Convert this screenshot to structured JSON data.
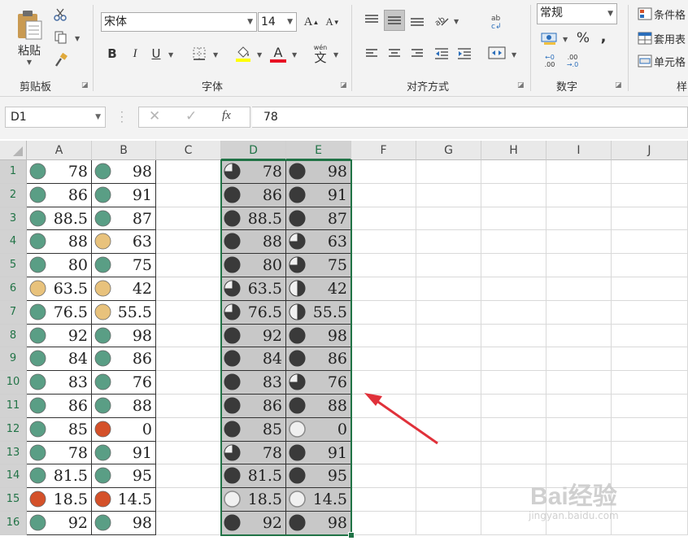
{
  "ribbon": {
    "clipboard": {
      "label": "剪贴板",
      "paste_label": "粘贴"
    },
    "font": {
      "label": "字体",
      "font_name": "宋体",
      "font_size": "14",
      "increase_symbol": "A",
      "decrease_symbol": "A",
      "bold": "B",
      "italic": "I",
      "underline": "U",
      "font_color_symbol": "A",
      "phonetic_top": "wén",
      "phonetic_char": "文"
    },
    "alignment": {
      "label": "对齐方式"
    },
    "number": {
      "label": "数字",
      "format": "常规",
      "percent": "%",
      "comma": ",",
      "inc_decimal_top": "←0",
      "inc_decimal_bottom": ".00",
      "dec_decimal_top": ".00",
      "dec_decimal_bottom": "→.0"
    },
    "styles": {
      "label": "样",
      "conditional": "条件格",
      "table": "套用表",
      "cell": "单元格"
    }
  },
  "formula_bar": {
    "name_box": "D1",
    "fx": "fx",
    "value": "78"
  },
  "columns": [
    "A",
    "B",
    "C",
    "D",
    "E",
    "F",
    "G",
    "H",
    "I",
    "J"
  ],
  "rows": [
    "1",
    "2",
    "3",
    "4",
    "5",
    "6",
    "7",
    "8",
    "9",
    "10",
    "11",
    "12",
    "13",
    "14",
    "15",
    "16"
  ],
  "colors": {
    "green": "#5a9e85",
    "yellow": "#e8c27c",
    "red": "#d4512a",
    "quarter_dark": "#3a3a3a",
    "accent": "#217346",
    "arrow": "#e0313a"
  },
  "sheet": {
    "A": [
      {
        "v": "78",
        "icon": "green"
      },
      {
        "v": "86",
        "icon": "green"
      },
      {
        "v": "88.5",
        "icon": "green"
      },
      {
        "v": "88",
        "icon": "green"
      },
      {
        "v": "80",
        "icon": "green"
      },
      {
        "v": "63.5",
        "icon": "yellow"
      },
      {
        "v": "76.5",
        "icon": "green"
      },
      {
        "v": "92",
        "icon": "green"
      },
      {
        "v": "84",
        "icon": "green"
      },
      {
        "v": "83",
        "icon": "green"
      },
      {
        "v": "86",
        "icon": "green"
      },
      {
        "v": "85",
        "icon": "green"
      },
      {
        "v": "78",
        "icon": "green"
      },
      {
        "v": "81.5",
        "icon": "green"
      },
      {
        "v": "18.5",
        "icon": "red"
      },
      {
        "v": "92",
        "icon": "green"
      }
    ],
    "B": [
      {
        "v": "98",
        "icon": "green"
      },
      {
        "v": "91",
        "icon": "green"
      },
      {
        "v": "87",
        "icon": "green"
      },
      {
        "v": "63",
        "icon": "yellow"
      },
      {
        "v": "75",
        "icon": "green"
      },
      {
        "v": "42",
        "icon": "yellow"
      },
      {
        "v": "55.5",
        "icon": "yellow"
      },
      {
        "v": "98",
        "icon": "green"
      },
      {
        "v": "86",
        "icon": "green"
      },
      {
        "v": "76",
        "icon": "green"
      },
      {
        "v": "88",
        "icon": "green"
      },
      {
        "v": "0",
        "icon": "red"
      },
      {
        "v": "91",
        "icon": "green"
      },
      {
        "v": "95",
        "icon": "green"
      },
      {
        "v": "14.5",
        "icon": "red"
      },
      {
        "v": "98",
        "icon": "green"
      }
    ],
    "D": [
      {
        "v": "78",
        "q": 3
      },
      {
        "v": "86",
        "q": 4
      },
      {
        "v": "88.5",
        "q": 4
      },
      {
        "v": "88",
        "q": 4
      },
      {
        "v": "80",
        "q": 4
      },
      {
        "v": "63.5",
        "q": 3
      },
      {
        "v": "76.5",
        "q": 3
      },
      {
        "v": "92",
        "q": 4
      },
      {
        "v": "84",
        "q": 4
      },
      {
        "v": "83",
        "q": 4
      },
      {
        "v": "86",
        "q": 4
      },
      {
        "v": "85",
        "q": 4
      },
      {
        "v": "78",
        "q": 3
      },
      {
        "v": "81.5",
        "q": 4
      },
      {
        "v": "18.5",
        "q": 0
      },
      {
        "v": "92",
        "q": 4
      }
    ],
    "E": [
      {
        "v": "98",
        "q": 4
      },
      {
        "v": "91",
        "q": 4
      },
      {
        "v": "87",
        "q": 4
      },
      {
        "v": "63",
        "q": 3
      },
      {
        "v": "75",
        "q": 3
      },
      {
        "v": "42",
        "q": 2
      },
      {
        "v": "55.5",
        "q": 2
      },
      {
        "v": "98",
        "q": 4
      },
      {
        "v": "86",
        "q": 4
      },
      {
        "v": "76",
        "q": 3
      },
      {
        "v": "88",
        "q": 4
      },
      {
        "v": "0",
        "q": 0
      },
      {
        "v": "91",
        "q": 4
      },
      {
        "v": "95",
        "q": 4
      },
      {
        "v": "14.5",
        "q": 0
      },
      {
        "v": "98",
        "q": 4
      }
    ]
  },
  "watermark": {
    "main": "Bai经验",
    "sub": "jingyan.baidu.com"
  }
}
